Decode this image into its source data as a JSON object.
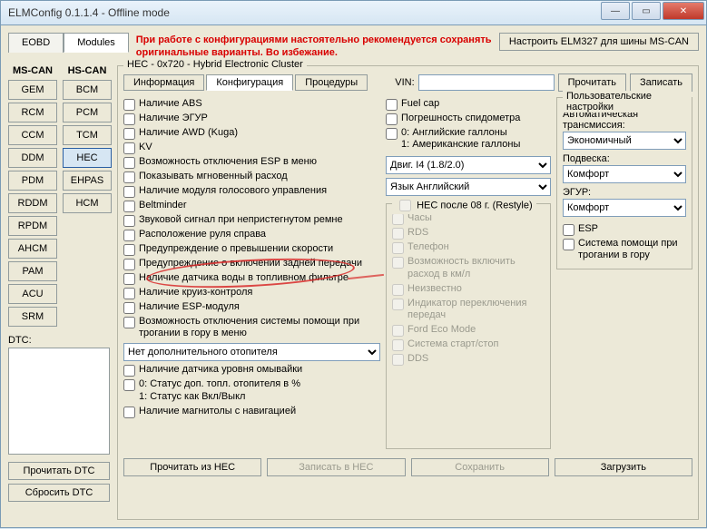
{
  "window": {
    "title": "ELMConfig 0.1.1.4 - Offline mode",
    "min": "—",
    "max": "▭",
    "close": "✕"
  },
  "topTabs": {
    "eobd": "EOBD",
    "modules": "Modules"
  },
  "warning": "При работе с конфигурациями настоятельно рекомендуется сохранять оригинальные варианты. Во избежание.",
  "btnConfigure": "Настроить ELM327 для шины MS-CAN",
  "sidebar": {
    "ms": {
      "head": "MS-CAN",
      "items": [
        "GEM",
        "RCM",
        "CCM",
        "DDM",
        "PDM",
        "RDDM",
        "RPDM",
        "AHCM",
        "PAM",
        "ACU",
        "SRM"
      ]
    },
    "hs": {
      "head": "HS-CAN",
      "items": [
        "BCM",
        "PCM",
        "TCM",
        "HEC",
        "EHPAS",
        "HCM"
      ]
    },
    "dtcLabel": "DTC:",
    "readDTC": "Прочитать DTC",
    "clearDTC": "Сбросить DTC"
  },
  "frameTitle": "HEC - 0x720 - Hybrid Electronic Cluster",
  "hectabs": {
    "info": "Информация",
    "cfg": "Конфигурация",
    "proc": "Процедуры"
  },
  "vinLabel": "VIN:",
  "vinValue": "",
  "btnRead": "Прочитать",
  "btnWrite": "Записать",
  "colA": {
    "items": [
      "Наличие ABS",
      "Наличие ЭГУР",
      "Наличие AWD (Kuga)",
      "KV",
      "Возможность отключения ESP в меню",
      "Показывать мгновенный расход",
      "Наличие модуля голосового управления",
      "Beltminder",
      "Звуковой сигнал при непристегнутом ремне",
      "Расположение руля справа",
      "Предупреждение о превышении скорости",
      "Предупреждение о включении задней передачи",
      "Наличие датчика воды в топливном фильтре",
      "Наличие круиз-контроля",
      "Наличие ESP-модуля",
      "Возможность отключения системы помощи при трогании в гору в меню"
    ],
    "heaterSelect": "Нет дополнительного отопителя",
    "tail": [
      "Наличие датчика уровня омывайки",
      "0: Статус доп. топл. отопителя в %\n1: Статус как Вкл/Выкл",
      "Наличие магнитолы с навигацией"
    ]
  },
  "colB": {
    "top": [
      "Fuel cap",
      "Погрешность спидометра",
      "0: Английские галлоны\n1: Американские галлоны"
    ],
    "engineSelect": "Двиг. I4 (1.8/2.0)",
    "langSelect": "Язык Английский",
    "restyleLegend": "HEC после 08 г. (Restyle)",
    "restyleItems": [
      "Часы",
      "RDS",
      "Телефон",
      "Возможность включить расход в км/л",
      "Неизвестно",
      "Индикатор переключения передач",
      "Ford Eco Mode",
      "Система старт/стоп",
      "DDS"
    ]
  },
  "colC": {
    "userLegend": "Пользовательские настройки",
    "transLabel": "Автоматическая трансмиссия:",
    "transValue": "Экономичный",
    "suspLabel": "Подвеска:",
    "suspValue": "Комфорт",
    "steerLabel": "ЭГУР:",
    "steerValue": "Комфорт",
    "esp": "ESP",
    "hill": "Система помощи при трогании в гору"
  },
  "bottom": {
    "read": "Прочитать из HEC",
    "write": "Записать в HEC",
    "save": "Сохранить",
    "load": "Загрузить"
  }
}
